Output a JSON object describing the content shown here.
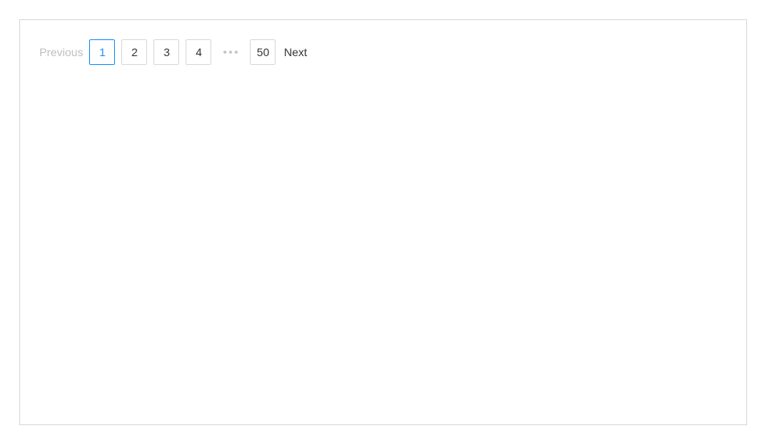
{
  "pagination": {
    "previous_label": "Previous",
    "next_label": "Next",
    "pages": [
      "1",
      "2",
      "3",
      "4"
    ],
    "last_page": "50",
    "active_page": "1",
    "ellipsis_icon": "more-horizontal-icon",
    "colors": {
      "active": "#1890ff",
      "disabled_text": "#bfbfbf",
      "text": "#333333",
      "border": "#d9d9d9"
    }
  }
}
